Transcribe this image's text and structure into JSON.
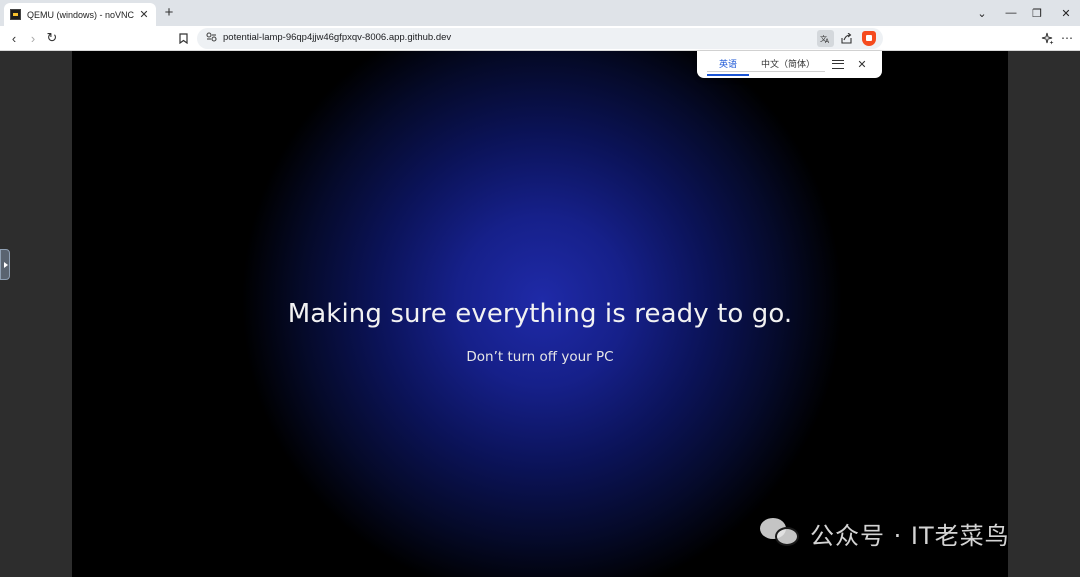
{
  "browser": {
    "tab": {
      "title": "QEMU (windows) - noVNC",
      "close": "✕"
    },
    "new_tab": "+",
    "window_controls": {
      "menu": "⌄",
      "minimize": "—",
      "restore": "❐",
      "close": "✕"
    },
    "nav": {
      "back": "‹",
      "forward": "›",
      "reload": "↻"
    },
    "address": {
      "url": "potential-lamp-96qp4jjw46gfpxqv-8006.app.github.dev"
    }
  },
  "translate_popup": {
    "tabs": [
      {
        "label": "英语",
        "active": true
      },
      {
        "label": "中文（简体）",
        "active": false
      }
    ],
    "close": "✕"
  },
  "vnc": {
    "headline": "Making sure everything is ready to go.",
    "subtext": "Don’t turn off your PC"
  },
  "watermark": {
    "text": "公众号 · IT老菜鸟"
  },
  "colors": {
    "brave_accent": "#f54b1e",
    "translate_active": "#1a55d6",
    "glow": "#1f2aa8"
  }
}
